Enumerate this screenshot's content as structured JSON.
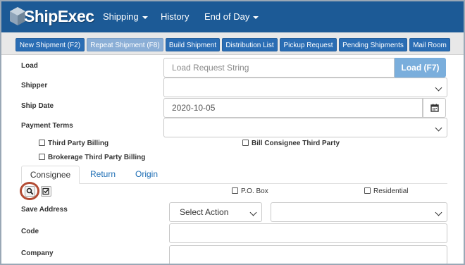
{
  "app": {
    "logo_text": "ShipExec"
  },
  "nav": {
    "items": [
      {
        "label": "Shipping",
        "dropdown": true
      },
      {
        "label": "History",
        "dropdown": false
      },
      {
        "label": "End of Day",
        "dropdown": true
      }
    ]
  },
  "toolbar": {
    "buttons": [
      {
        "label": "New Shipment (F2)",
        "active": false
      },
      {
        "label": "Repeat Shipment (F8)",
        "active": true
      },
      {
        "label": "Build Shipment",
        "active": false
      },
      {
        "label": "Distribution List",
        "active": false
      },
      {
        "label": "Pickup Request",
        "active": false
      },
      {
        "label": "Pending Shipments",
        "active": false
      },
      {
        "label": "Mail Room",
        "active": false
      }
    ]
  },
  "form": {
    "load": {
      "label": "Load",
      "placeholder": "Load Request String",
      "button_label": "Load (F7)"
    },
    "shipper": {
      "label": "Shipper",
      "value": ""
    },
    "ship_date": {
      "label": "Ship Date",
      "value": "2020-10-05"
    },
    "payment_terms": {
      "label": "Payment Terms",
      "value": ""
    },
    "checkboxes": {
      "third_party_billing": {
        "label": "Third Party Billing",
        "checked": false
      },
      "bill_consignee_third_party": {
        "label": "Bill Consignee Third Party",
        "checked": false
      },
      "brokerage_third_party_billing": {
        "label": "Brokerage Third Party Billing",
        "checked": false
      }
    }
  },
  "tabs": {
    "items": [
      {
        "label": "Consignee",
        "active": true
      },
      {
        "label": "Return",
        "active": false
      },
      {
        "label": "Origin",
        "active": false
      }
    ]
  },
  "consignee": {
    "po_box": {
      "label": "P.O. Box",
      "checked": false
    },
    "residential": {
      "label": "Residential",
      "checked": false
    },
    "save_address": {
      "label": "Save Address",
      "action_value": "Select Action",
      "second_value": ""
    },
    "code": {
      "label": "Code",
      "value": ""
    },
    "company": {
      "label": "Company",
      "value": ""
    }
  },
  "colors": {
    "nav_bg": "#1c5a96",
    "button_blue": "#2a6db4",
    "button_active": "#8aaed6",
    "load_button": "#7aaedc",
    "highlight_ring": "#b24b33"
  },
  "icons": {
    "search": "search-icon",
    "checklist": "checklist-icon",
    "calendar": "calendar-icon",
    "chevron": "chevron-down-icon"
  }
}
